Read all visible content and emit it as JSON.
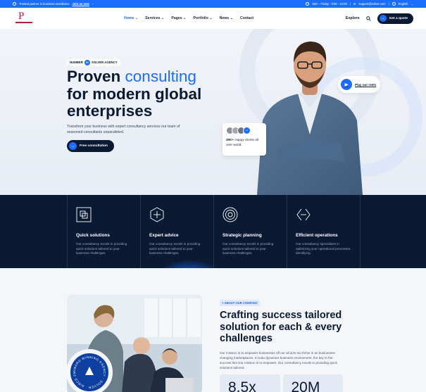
{
  "topbar": {
    "tagline": "Trusted partner in business excellence",
    "join_link": "Join us now",
    "hours": "Mon - Friday : 9:00 - 10:00",
    "email": "support@solver.com",
    "language": "English"
  },
  "nav": {
    "items": [
      "Home",
      "Services",
      "Pages",
      "Portfolio",
      "News",
      "Contact"
    ],
    "explore": "Explore",
    "quote_button": "Get a quote"
  },
  "hero": {
    "badge_number": "01",
    "badge_prefix": "NUMBER",
    "badge_suffix": "SOLVER AGENCY",
    "title_lead": "Proven",
    "title_accent": "consulting",
    "title_rest": "for modern global enterprises",
    "description": "Transform your business with expert consultancy services our team of seasoned consultants unparalleled.",
    "cta": "Free consultation",
    "play_label": "Play our reels",
    "clients_count": "39K+",
    "clients_text": "Happy clients all over world."
  },
  "services": [
    {
      "title": "Quick solutions",
      "desc": "Our consultancy excels in providing quick solutions tailored to your business challenges",
      "icon": "layers-icon"
    },
    {
      "title": "Expert advice",
      "desc": "Our consultancy excels in providing quick solutions tailored to your business challenges",
      "icon": "target-icon"
    },
    {
      "title": "Strategic planning",
      "desc": "Our consultancy excels in providing quick solutions tailored to your business challenges",
      "icon": "compass-icon"
    },
    {
      "title": "Efficient operations",
      "desc": "Our consultancy specialises in optimizing your operational processes, identifying",
      "icon": "arrows-icon"
    }
  ],
  "about": {
    "tag": "+ ABOUT OUR COMPANY",
    "title": "Crafting success tailored solution for each & every challenges",
    "description": "Our mission is to empower businesses off our all size too thrive in an businesses changing marketplaces. In toda dynamics business environment, the key to the success lies Our mission is to empower. Our consultancy excels in providing quick solutions tailored.",
    "stamp_text": "AWARD WINNING AGENCY · SOLVER · SINCE 2000 ·",
    "stat_1": "8.5x",
    "stat_2": "20M"
  },
  "colors": {
    "accent": "#1a6dff",
    "navy": "#0b1a33"
  }
}
